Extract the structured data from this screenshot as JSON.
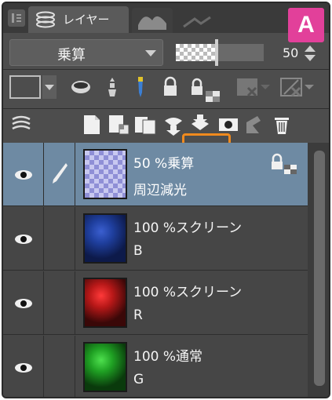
{
  "panel": {
    "tab_label": "レイヤー",
    "badge": "A"
  },
  "properties": {
    "blend_mode": "乗算",
    "opacity_value": "50",
    "opacity_level": 0.5
  },
  "toolbar_row1": {
    "icons": [
      "color-box",
      "clipping-icon",
      "reference-icon",
      "draft-icon",
      "lock-icon",
      "lock-transparent-icon",
      "mask-disabled-icon",
      "mask-apply-icon"
    ]
  },
  "toolbar_row2": {
    "icons": [
      "layers-icon",
      "new-raster-icon",
      "new-vector-icon",
      "new-folder-icon",
      "transfer-down-icon",
      "merge-down-icon",
      "mask-icon",
      "ruler-icon",
      "delete-icon"
    ]
  },
  "layers": [
    {
      "opacity_mode": "50 %乗算",
      "name": "周辺減光",
      "active": true,
      "locked": true,
      "thumb_color": "#8f8fd6"
    },
    {
      "opacity_mode": "100 %スクリーン",
      "name": "B",
      "active": false,
      "locked": false,
      "thumb_color": "#1f3f9e"
    },
    {
      "opacity_mode": "100 %スクリーン",
      "name": "R",
      "active": false,
      "locked": false,
      "thumb_color": "#b81818"
    },
    {
      "opacity_mode": "100 %通常",
      "name": "G",
      "active": false,
      "locked": false,
      "thumb_color": "#1fa023"
    }
  ],
  "colors": {
    "accent": "#e2409a",
    "highlight": "#f08a1e",
    "active_layer": "#6e8aa3"
  }
}
